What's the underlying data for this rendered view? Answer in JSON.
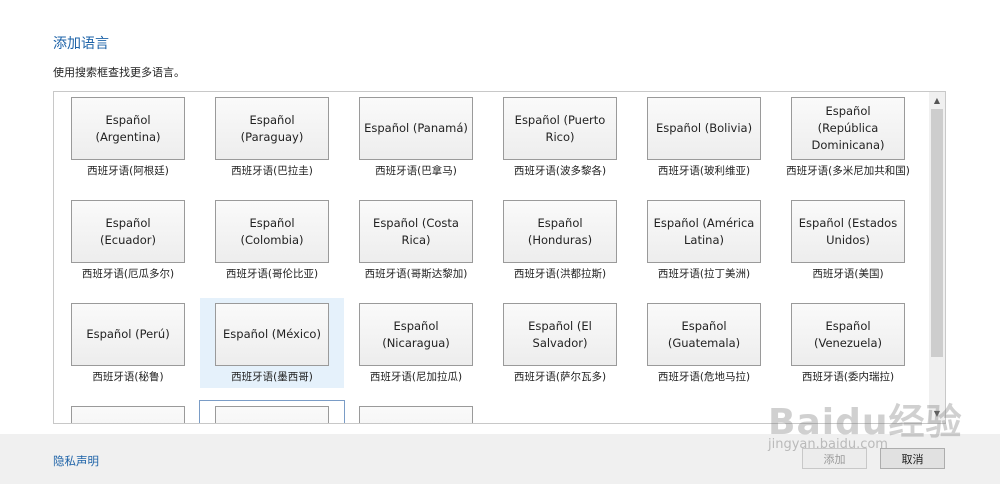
{
  "dialog": {
    "title": "添加语言",
    "subtitle": "使用搜索框查找更多语言。",
    "privacy_link": "隐私声明",
    "add_button": "添加",
    "cancel_button": "取消"
  },
  "languages": [
    {
      "name": "Español (Argentina)",
      "label": "西班牙语(阿根廷)"
    },
    {
      "name": "Español (Paraguay)",
      "label": "西班牙语(巴拉圭)"
    },
    {
      "name": "Español (Panamá)",
      "label": "西班牙语(巴拿马)"
    },
    {
      "name": "Español (Puerto Rico)",
      "label": "西班牙语(波多黎各)"
    },
    {
      "name": "Español (Bolivia)",
      "label": "西班牙语(玻利维亚)"
    },
    {
      "name": "Español (República Dominicana)",
      "label": "西班牙语(多米尼加共和国)"
    },
    {
      "name": "Español (Ecuador)",
      "label": "西班牙语(厄瓜多尔)"
    },
    {
      "name": "Español (Colombia)",
      "label": "西班牙语(哥伦比亚)"
    },
    {
      "name": "Español (Costa Rica)",
      "label": "西班牙语(哥斯达黎加)"
    },
    {
      "name": "Español (Honduras)",
      "label": "西班牙语(洪都拉斯)"
    },
    {
      "name": "Español (América Latina)",
      "label": "西班牙语(拉丁美洲)"
    },
    {
      "name": "Español (Estados Unidos)",
      "label": "西班牙语(美国)"
    },
    {
      "name": "Español (Perú)",
      "label": "西班牙语(秘鲁)"
    },
    {
      "name": "Español (México)",
      "label": "西班牙语(墨西哥)"
    },
    {
      "name": "Español (Nicaragua)",
      "label": "西班牙语(尼加拉瓜)"
    },
    {
      "name": "Español (El Salvador)",
      "label": "西班牙语(萨尔瓦多)"
    },
    {
      "name": "Español (Guatemala)",
      "label": "西班牙语(危地马拉)"
    },
    {
      "name": "Español (Venezuela)",
      "label": "西班牙语(委内瑞拉)"
    }
  ],
  "selected_index": 13,
  "watermark": {
    "main": "Baidu经验",
    "sub": "jingyan.baidu.com"
  }
}
